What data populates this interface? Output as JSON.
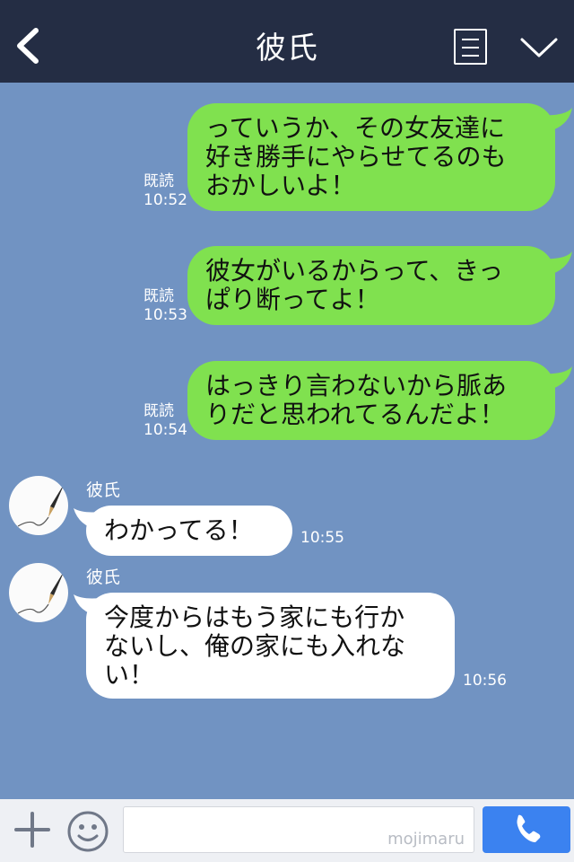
{
  "header": {
    "title": "彼氏",
    "back_icon": "chevron-left-icon",
    "menu_icon": "document-menu-icon",
    "collapse_icon": "chevron-down-icon"
  },
  "messages": [
    {
      "side": "sent",
      "lines": [
        "っていうか、その女友達に",
        "好き勝手にやらせてるのも",
        "おかしいよ！"
      ],
      "read": "既読",
      "time": "10:52"
    },
    {
      "side": "sent",
      "lines": [
        "彼女がいるからって、きっ",
        "ぱり断ってよ！"
      ],
      "read": "既読",
      "time": "10:53"
    },
    {
      "side": "sent",
      "lines": [
        "はっきり言わないから脈あ",
        "りだと思われてるんだよ！"
      ],
      "read": "既読",
      "time": "10:54"
    },
    {
      "side": "received",
      "sender": "彼氏",
      "lines": [
        "わかってる！"
      ],
      "time": "10:55"
    },
    {
      "side": "received",
      "sender": "彼氏",
      "lines": [
        "今度からはもう家にも行か",
        "ないし、俺の家にも入れな",
        "い！"
      ],
      "time": "10:56"
    }
  ],
  "bottom_bar": {
    "plus_icon": "plus-icon",
    "emoji_icon": "smiley-icon",
    "input_value": "",
    "watermark": "mojimaru",
    "call_icon": "phone-icon"
  },
  "colors": {
    "header": "#242d44",
    "background": "#7193c2",
    "sent_bubble": "#80e14f",
    "received_bubble": "#ffffff",
    "call_button": "#3b82f0"
  }
}
